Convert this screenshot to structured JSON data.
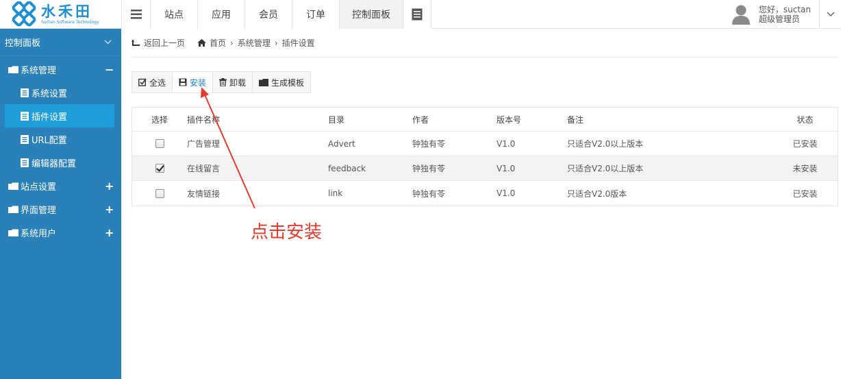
{
  "header": {
    "logo_cn": "水禾田",
    "logo_en": "Suctan Software Technology",
    "nav": [
      "站点",
      "应用",
      "会员",
      "订单",
      "控制面板"
    ],
    "greeting": "您好，suctan",
    "role": "超级管理员"
  },
  "sidebar": {
    "title": "控制面板",
    "groups": [
      {
        "label": "系统管理",
        "toggle": "−",
        "items": [
          "系统设置",
          "插件设置",
          "URL配置",
          "编辑器配置"
        ]
      },
      {
        "label": "站点设置",
        "toggle": "+"
      },
      {
        "label": "界面管理",
        "toggle": "+"
      },
      {
        "label": "系统用户",
        "toggle": "+"
      }
    ]
  },
  "breadcrumb": {
    "back": "返回上一页",
    "items": [
      "首页",
      "系统管理",
      "插件设置"
    ]
  },
  "toolbar": {
    "select_all": "全选",
    "install": "安装",
    "uninstall": "卸载",
    "generate": "生成模板"
  },
  "table": {
    "headers": [
      "选择",
      "插件名称",
      "目录",
      "作者",
      "版本号",
      "备注",
      "状态"
    ],
    "rows": [
      {
        "checked": false,
        "name": "广告管理",
        "dir": "Advert",
        "author": "钟独有苓",
        "version": "V1.0",
        "note": "只适合V2.0以上版本",
        "status": "已安装"
      },
      {
        "checked": true,
        "name": "在线留言",
        "dir": "feedback",
        "author": "钟独有苓",
        "version": "V1.0",
        "note": "只适合V2.0以上版本",
        "status": "未安装"
      },
      {
        "checked": false,
        "name": "友情链接",
        "dir": "link",
        "author": "钟独有苓",
        "version": "V1.0",
        "note": "只适合V2.0版本",
        "status": "已安装"
      }
    ]
  },
  "annotation": {
    "text": "点击安装",
    "color": "#e53a2e"
  },
  "colors": {
    "sidebar": "#2a80b9",
    "sidebar_active": "#1e9fda",
    "brand": "#1e8fd0"
  }
}
